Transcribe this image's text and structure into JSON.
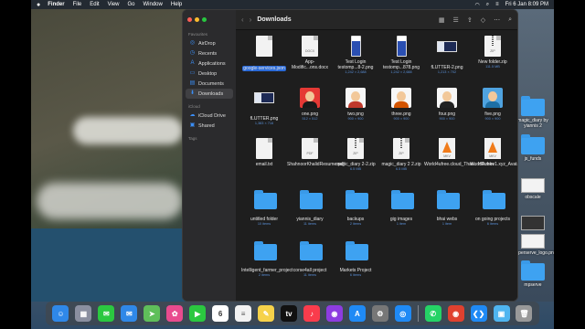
{
  "menubar": {
    "app": "Finder",
    "items": [
      "File",
      "Edit",
      "View",
      "Go",
      "Window",
      "Help"
    ],
    "datetime": "Fri 6 Jan  8:09 PM"
  },
  "finder": {
    "title": "Downloads",
    "sidebar": {
      "favorites_header": "Favourites",
      "favorites": [
        {
          "label": "AirDrop",
          "icon": "airdrop-icon"
        },
        {
          "label": "Recents",
          "icon": "clock-icon"
        },
        {
          "label": "Applications",
          "icon": "applications-icon"
        },
        {
          "label": "Desktop",
          "icon": "desktop-icon"
        },
        {
          "label": "Documents",
          "icon": "document-icon"
        },
        {
          "label": "Downloads",
          "icon": "download-icon"
        }
      ],
      "icloud_header": "iCloud",
      "icloud": [
        {
          "label": "iCloud Drive",
          "icon": "cloud-icon"
        },
        {
          "label": "Shared",
          "icon": "shared-folder-icon"
        }
      ],
      "tags_header": "Tags"
    },
    "files": [
      {
        "name": "google-services.json",
        "meta": "",
        "kind": "doc",
        "label": "",
        "selected": true
      },
      {
        "name": "App-Modific...ons.docx",
        "meta": "",
        "kind": "doc",
        "label": "DOCX"
      },
      {
        "name": "Test Login testomp...8-2.png",
        "meta": "1,242 × 2,688",
        "kind": "phone"
      },
      {
        "name": "Test Login testomp...878.png",
        "meta": "1,242 × 2,688",
        "kind": "phone"
      },
      {
        "name": "fLUTTER-2.png",
        "meta": "1,213 × 702",
        "kind": "wide"
      },
      {
        "name": "New folder.zip",
        "meta": "111.5 MB",
        "kind": "zip",
        "label": "ZIP"
      },
      {
        "name": "fLUTTER.png",
        "meta": "1,383 × 716",
        "kind": "wide"
      },
      {
        "name": "one.png",
        "meta": "512 × 512",
        "kind": "avatar",
        "bg": "#e53935",
        "shirt": "#1a1a1a"
      },
      {
        "name": "two.png",
        "meta": "900 × 900",
        "kind": "avatar",
        "bg": "#f7f7f7",
        "shirt": "#c0392b"
      },
      {
        "name": "three.png",
        "meta": "900 × 900",
        "kind": "avatar",
        "bg": "#f7f7f7",
        "shirt": "#d35400"
      },
      {
        "name": "four.png",
        "meta": "900 × 900",
        "kind": "avatar",
        "bg": "#f7f7f7",
        "shirt": "#222"
      },
      {
        "name": "five.png",
        "meta": "900 × 900",
        "kind": "avatar",
        "bg": "#4fa3e0",
        "shirt": "#1d6fa5"
      },
      {
        "name": "email.txt",
        "meta": "",
        "kind": "doc",
        "label": ""
      },
      {
        "name": "ShahnoorKhalidResume.pdf",
        "meta": "",
        "kind": "doc",
        "label": "PDF"
      },
      {
        "name": "magic_diary 2-2.zip",
        "meta": "6.5 MB",
        "kind": "zip",
        "label": "ZIP"
      },
      {
        "name": "magic_diary 2 2.zip",
        "meta": "6.5 MB",
        "kind": "zip",
        "label": "ZIP"
      },
      {
        "name": "World4ufree.cloud_Than...HD.mkv",
        "meta": "",
        "kind": "cone",
        "label": "MKV"
      },
      {
        "name": "World4ufree1.xyz_Avatar...EVC.mkv",
        "meta": "",
        "kind": "cone",
        "label": "MKV"
      },
      {
        "name": "untitled folder",
        "meta": "10 items",
        "kind": "folder"
      },
      {
        "name": "yiannis_diary",
        "meta": "11 items",
        "kind": "folder"
      },
      {
        "name": "backups",
        "meta": "2 items",
        "kind": "folder"
      },
      {
        "name": "gig images",
        "meta": "1 item",
        "kind": "folder"
      },
      {
        "name": "bhai webs",
        "meta": "1 item",
        "kind": "folder"
      },
      {
        "name": "on going projects",
        "meta": "6 items",
        "kind": "folder"
      },
      {
        "name": "Intelligent_farmer_project",
        "meta": "2 items",
        "kind": "folder"
      },
      {
        "name": "corse4all project",
        "meta": "11 items",
        "kind": "folder"
      },
      {
        "name": "Markets Project",
        "meta": "6 items",
        "kind": "folder"
      }
    ]
  },
  "desktop": [
    {
      "name": "magic_diary by yiannis 2",
      "kind": "folder"
    },
    {
      "name": "js_funds",
      "kind": "folder"
    },
    {
      "name": "obscale",
      "kind": "mini"
    },
    {
      "name": "",
      "kind": "mini-dark"
    },
    {
      "name": "mperserve_logo.png",
      "kind": "mini"
    },
    {
      "name": "mpserve",
      "kind": "folder"
    }
  ],
  "dock": [
    {
      "name": "finder",
      "color": "#2f88e8",
      "glyph": "☺"
    },
    {
      "name": "launchpad",
      "color": "#8a8fa0",
      "glyph": "▦"
    },
    {
      "name": "messages",
      "color": "#2bc840",
      "glyph": "✉"
    },
    {
      "name": "mail",
      "color": "#2f88e8",
      "glyph": "✉"
    },
    {
      "name": "maps",
      "color": "#5fbf5a",
      "glyph": "➤"
    },
    {
      "name": "photos",
      "color": "#e94b8e",
      "glyph": "✿"
    },
    {
      "name": "facetime",
      "color": "#2bc840",
      "glyph": "▶"
    },
    {
      "name": "calendar",
      "color": "#ffffff",
      "glyph": "6",
      "fg": "#333"
    },
    {
      "name": "reminders",
      "color": "#f2f2f2",
      "glyph": "≡",
      "fg": "#555"
    },
    {
      "name": "notes",
      "color": "#f6d24a",
      "glyph": "✎"
    },
    {
      "name": "apple-tv",
      "color": "#111111",
      "glyph": "tv"
    },
    {
      "name": "music",
      "color": "#fa3c4c",
      "glyph": "♪"
    },
    {
      "name": "podcasts",
      "color": "#8d3ce0",
      "glyph": "◉"
    },
    {
      "name": "app-store",
      "color": "#1f8af5",
      "glyph": "A"
    },
    {
      "name": "system-preferences",
      "color": "#777777",
      "glyph": "⚙"
    },
    {
      "name": "safari",
      "color": "#1f8af5",
      "glyph": "◎"
    },
    {
      "name": "sep"
    },
    {
      "name": "whatsapp",
      "color": "#25d366",
      "glyph": "✆"
    },
    {
      "name": "chrome",
      "color": "#e0412f",
      "glyph": "◉"
    },
    {
      "name": "vscode",
      "color": "#1f8af5",
      "glyph": "❮❯"
    },
    {
      "name": "preview",
      "color": "#4fb5f0",
      "glyph": "▣"
    },
    {
      "name": "trash",
      "color": "#999999",
      "glyph": "🗑"
    }
  ]
}
